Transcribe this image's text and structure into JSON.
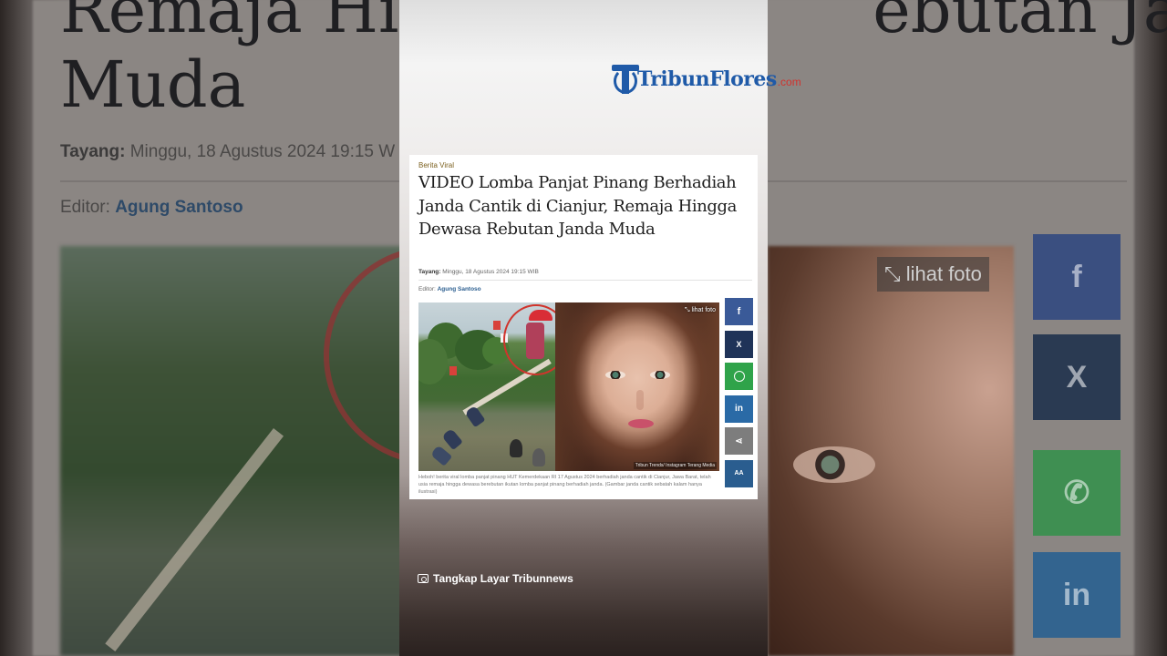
{
  "brand": {
    "name": "TribunFlores",
    "domain": ".com",
    "color": "#1f5aa8",
    "domain_color": "#d1322e"
  },
  "article": {
    "category": "Berita Viral",
    "title": "VIDEO Lomba Panjat Pinang Berhadiah Janda Cantik di Cianjur, Remaja Hingga Dewasa Rebutan Janda Muda",
    "tayang_label": "Tayang:",
    "tayang_value": "Minggu, 18 Agustus 2024 19:15 WIB",
    "editor_label": "Editor:",
    "editor_name": "Agung Santoso",
    "photo": {
      "lihat_label": "lihat foto",
      "credit": "Tribun Trends/ Instagram Terang Media",
      "caption": "Heboh! berita viral lomba panjat pinang HUT Kemerdekaan RI 17 Agustus 2024 berhadiah janda cantik di Cianjur, Jawa Barat, telah usia remaja hingga dewasa berebutan ikutan lomba panjat pinang berhadiah janda. (Gambar janda cantik sebatah kalam hanya ilustrasi)"
    }
  },
  "background": {
    "title_fragment_1": "Remaja Hing",
    "title_fragment_2": "ebutan Janda",
    "title_line2": "Muda",
    "tayang_label": "Tayang:",
    "tayang_value": "Minggu, 18 Agustus 2024 19:15 W",
    "editor_label": "Editor:",
    "editor_name": "Agung Santoso",
    "lihat_label": "lihat foto"
  },
  "share": [
    {
      "icon": "facebook-icon",
      "glyph": "f",
      "color": "#3a5a98"
    },
    {
      "icon": "x-icon",
      "glyph": "X",
      "color": "#1f3358"
    },
    {
      "icon": "whatsapp-icon",
      "glyph": "W",
      "color": "#2fa34a"
    },
    {
      "icon": "linkedin-icon",
      "glyph": "in",
      "color": "#2a6aa6"
    },
    {
      "icon": "share-icon",
      "glyph": "<",
      "color": "#7d7d7d"
    },
    {
      "icon": "font-size-icon",
      "glyph": "AA",
      "color": "#2a5d8f"
    }
  ],
  "footer_note": "Tangkap Layar Tribunnews"
}
